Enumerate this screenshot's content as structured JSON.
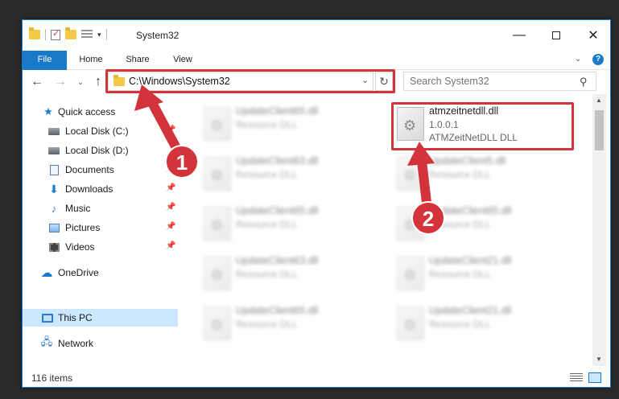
{
  "window": {
    "title": "System32",
    "minimize_glyph": "—",
    "close_glyph": "✕"
  },
  "ribbon": {
    "tabs": [
      "File",
      "Home",
      "Share",
      "View"
    ],
    "help_label": "?"
  },
  "navigation": {
    "back_glyph": "←",
    "forward_glyph": "→",
    "recent_glyph": "⌄",
    "up_glyph": "↑",
    "address": "C:\\Windows\\System32",
    "address_dropdown_glyph": "⌄",
    "refresh_glyph": "↻",
    "search_placeholder": "Search System32",
    "search_glyph": "⚲"
  },
  "sidebar": {
    "items": [
      {
        "label": "Quick access",
        "icon": "star-icon"
      },
      {
        "label": "Local Disk (C:)",
        "icon": "drive-icon",
        "pinned": true
      },
      {
        "label": "Local Disk (D:)",
        "icon": "drive-icon"
      },
      {
        "label": "Documents",
        "icon": "documents-icon",
        "pinned": true
      },
      {
        "label": "Downloads",
        "icon": "downloads-icon",
        "pinned": true
      },
      {
        "label": "Music",
        "icon": "music-icon",
        "pinned": true
      },
      {
        "label": "Pictures",
        "icon": "pictures-icon",
        "pinned": true
      },
      {
        "label": "Videos",
        "icon": "videos-icon",
        "pinned": true
      },
      {
        "label": "OneDrive",
        "icon": "cloud-icon"
      },
      {
        "label": "This PC",
        "icon": "computer-icon",
        "selected": true
      },
      {
        "label": "Network",
        "icon": "network-icon"
      }
    ]
  },
  "files": [
    {
      "name": "UpdateClient65.dll",
      "type": "Resource DLL",
      "blurred": true
    },
    {
      "name": "atmzeitnetdll.dll",
      "version": "1.0.0.1",
      "type": "ATMZeitNetDLL DLL",
      "blurred": false
    },
    {
      "name": "UpdateClient63.dll",
      "type": "Resource DLL",
      "blurred": true
    },
    {
      "name": "UpdateClient5.dll",
      "type": "Resource DLL",
      "blurred": true
    },
    {
      "name": "UpdateClient65.dll",
      "type": "Resource DLL",
      "blurred": true
    },
    {
      "name": "UpdateClient65.dll",
      "type": "Resource DLL",
      "blurred": true
    },
    {
      "name": "UpdateClient63.dll",
      "type": "Resource DLL",
      "blurred": true
    },
    {
      "name": "UpdateClient21.dll",
      "type": "Resource DLL",
      "blurred": true
    },
    {
      "name": "UpdateClient65.dll",
      "type": "Resource DLL",
      "blurred": true
    },
    {
      "name": "UpdateClient21.dll",
      "type": "Resource DLL",
      "blurred": true
    }
  ],
  "status": {
    "item_count": "116 items"
  },
  "annotations": {
    "step1": "1",
    "step2": "2",
    "color": "#d3333a"
  }
}
